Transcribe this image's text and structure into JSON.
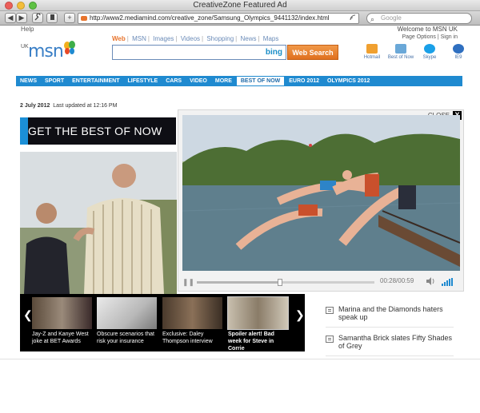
{
  "browser": {
    "title": "CreativeZone Featured Ad",
    "url": "http://www2.mediamind.com/creative_zone/Samsung_Olympics_9441132/index.html",
    "search_placeholder": "Google",
    "back_label": "◀",
    "forward_label": "▶",
    "tool_icon": "wrench-icon",
    "new_tab_label": "+",
    "rss_label": "RSS"
  },
  "header": {
    "help": "Help",
    "welcome": "Welcome to MSN UK",
    "options": "Page Options | Sign in",
    "region": "UK",
    "logo": "msn",
    "search_tabs": [
      "Web",
      "MSN",
      "Images",
      "Videos",
      "Shopping",
      "News",
      "Maps"
    ],
    "search_value": "",
    "bing": "bing",
    "search_button": "Web Search",
    "quicklinks": [
      {
        "label": "Hotmail",
        "color": "#f0a030"
      },
      {
        "label": "Best of Now",
        "color": "#6aa8d8"
      },
      {
        "label": "Skype",
        "color": "#1aa0e8"
      },
      {
        "label": "IE9",
        "color": "#2f6fc0"
      }
    ]
  },
  "nav": {
    "items": [
      "NEWS",
      "SPORT",
      "ENTERTAINMENT",
      "LIFESTYLE",
      "CARS",
      "VIDEO",
      "MORE",
      "BEST OF NOW",
      "EURO 2012",
      "OLYMPICS 2012"
    ],
    "selected": "BEST OF NOW"
  },
  "date": {
    "day": "2 July 2012",
    "updated": "Last updated at 12:16 PM"
  },
  "banner": {
    "text": "GET THE BEST OF NOW"
  },
  "carousel": {
    "items": [
      {
        "caption": "Jay-Z and Kanye West joke at BET Awards",
        "color": "#7a6a5a"
      },
      {
        "caption": "Obscure scenarios that risk your insurance",
        "color": "#c8c8c8"
      },
      {
        "caption": "Exclusive: Daley Thompson interview",
        "color": "#6a5a4a"
      },
      {
        "caption": "Spoiler alert! Bad week for Steve in Corrie",
        "color": "#a89c8a"
      }
    ]
  },
  "video": {
    "close_label": "CLOSE",
    "close_x": "X",
    "time": "00:28/00:59",
    "progress": 0.47
  },
  "links": [
    {
      "text": "Marina and the Diamonds haters speak up"
    },
    {
      "text": "Samantha Brick slates Fifty Shades of Grey"
    }
  ]
}
